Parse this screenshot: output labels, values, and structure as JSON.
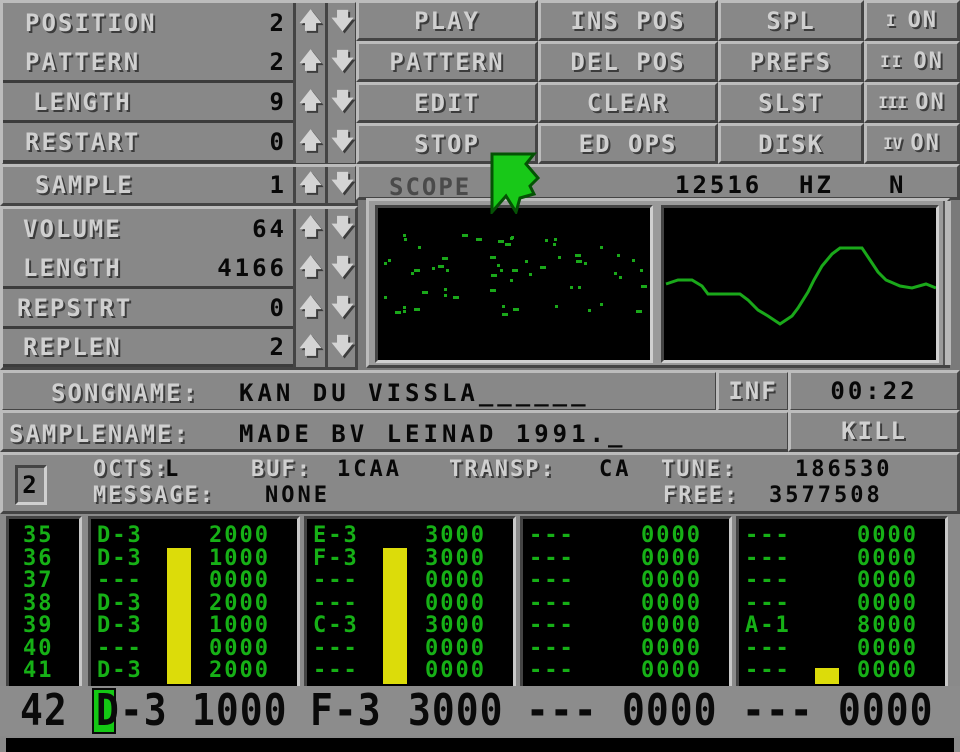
{
  "song_controls": [
    {
      "label": "POSITION",
      "value": "2"
    },
    {
      "label": "PATTERN",
      "value": "2"
    },
    {
      "label": "LENGTH",
      "value": "9"
    },
    {
      "label": "RESTART",
      "value": "0"
    }
  ],
  "sample_controls": [
    {
      "label": "SAMPLE",
      "value": "1"
    },
    {
      "label": "VOLUME",
      "value": "64"
    },
    {
      "label": "LENGTH",
      "value": "4166"
    },
    {
      "label": "REPSTRT",
      "value": "0"
    },
    {
      "label": "REPLEN",
      "value": "2"
    }
  ],
  "arrows": {
    "up": "🡅",
    "down": "🡇"
  },
  "main_buttons": [
    [
      "PLAY",
      "INS POS",
      "SPL"
    ],
    [
      "PATTERN",
      "DEL POS",
      "PREFS"
    ],
    [
      "EDIT",
      "CLEAR",
      "SLST"
    ],
    [
      "STOP",
      "ED OPS",
      "DISK"
    ]
  ],
  "channel_toggles": [
    {
      "channel": "I",
      "state": "ON"
    },
    {
      "channel": "II",
      "state": "ON"
    },
    {
      "channel": "III",
      "state": "ON"
    },
    {
      "channel": "IV",
      "state": "ON"
    }
  ],
  "scope": {
    "label": "SCOPE",
    "frequency": "12516",
    "unit": "HZ",
    "mode": "N"
  },
  "song": {
    "label": "SONGNAME:",
    "name": "KAN DU VISSLA______",
    "info_button": "INF",
    "time": "00:22"
  },
  "sample": {
    "label": "SAMPLENAME:",
    "name": "MADE BV LEINAD 1991._",
    "kill_button": "KILL"
  },
  "status": {
    "octave_box": "2",
    "octs_label": "OCTS:",
    "octs_value": "L",
    "buf_label": "BUF:",
    "buf_value": "1CAA",
    "transp_label": "TRANSP:",
    "transp_value": "CA",
    "tune_label": "TUNE:",
    "tune_value": "186530",
    "message_label": "MESSAGE:",
    "message_value": "NONE",
    "free_label": "FREE:",
    "free_value": "3577508"
  },
  "pattern": {
    "row_numbers": [
      "35",
      "36",
      "37",
      "38",
      "39",
      "40",
      "41"
    ],
    "tracks": [
      {
        "notes": [
          "D-3",
          "D-3",
          "---",
          "D-3",
          "D-3",
          "---",
          "D-3"
        ],
        "effects": [
          "2000",
          "1000",
          "0000",
          "2000",
          "1000",
          "0000",
          "2000"
        ],
        "vu_level": 0.85
      },
      {
        "notes": [
          "E-3",
          "F-3",
          "---",
          "---",
          "C-3",
          "---",
          "---"
        ],
        "effects": [
          "3000",
          "3000",
          "0000",
          "0000",
          "3000",
          "0000",
          "0000"
        ],
        "vu_level": 0.85
      },
      {
        "notes": [
          "---",
          "---",
          "---",
          "---",
          "---",
          "---",
          "---"
        ],
        "effects": [
          "0000",
          "0000",
          "0000",
          "0000",
          "0000",
          "0000",
          "0000"
        ],
        "vu_level": 0
      },
      {
        "notes": [
          "---",
          "---",
          "---",
          "---",
          "A-1",
          "---",
          "---"
        ],
        "effects": [
          "0000",
          "0000",
          "0000",
          "0000",
          "8000",
          "0000",
          "0000"
        ],
        "vu_level": 0.1
      }
    ],
    "current_row": {
      "number": "42",
      "tracks": [
        {
          "note": "D-3",
          "effect": "1000"
        },
        {
          "note": "F-3",
          "effect": "3000"
        },
        {
          "note": "---",
          "effect": "0000"
        },
        {
          "note": "---",
          "effect": "0000"
        }
      ]
    }
  },
  "colors": {
    "pattern_text": "#16b016",
    "vu_meter": "#dcdc0a",
    "cursor": "#14c814",
    "panel": "#888888"
  }
}
